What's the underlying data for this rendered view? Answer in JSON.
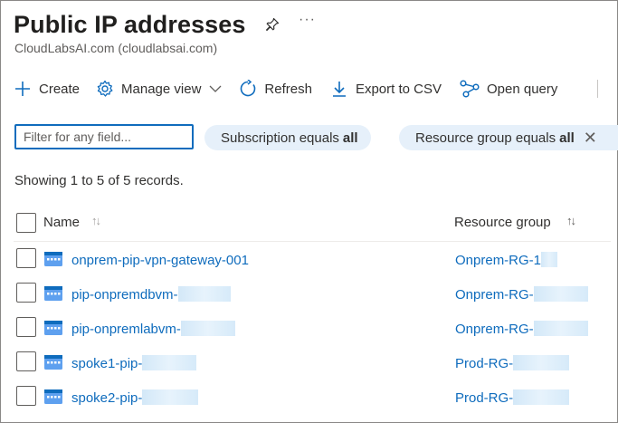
{
  "header": {
    "title": "Public IP addresses",
    "more": "···",
    "subtitle": "CloudLabsAI.com (cloudlabsai.com)"
  },
  "toolbar": {
    "create": "Create",
    "manage_view": "Manage view",
    "refresh": "Refresh",
    "export_csv": "Export to CSV",
    "open_query": "Open query"
  },
  "filters": {
    "search_placeholder": "Filter for any field...",
    "search_value": "",
    "subscription_prefix": "Subscription equals",
    "subscription_value": "all",
    "rg_prefix": "Resource group equals",
    "rg_value": "all",
    "close": "✕"
  },
  "records_text": "Showing 1 to 5 of 5 records.",
  "grid": {
    "col_name": "Name",
    "col_rg": "Resource group",
    "sort_glyph": "↑↓",
    "rows": [
      {
        "name": "onprem-pip-vpn-gateway-001",
        "rg": "Onprem-RG-1"
      },
      {
        "name": "pip-onpremdbvm-",
        "rg": "Onprem-RG-"
      },
      {
        "name": "pip-onpremlabvm-",
        "rg": "Onprem-RG-"
      },
      {
        "name": "spoke1-pip-",
        "rg": "Prod-RG-"
      },
      {
        "name": "spoke2-pip-",
        "rg": "Prod-RG-"
      }
    ]
  },
  "colors": {
    "accent": "#0f6cbd",
    "pill_bg": "#e6f0fa"
  }
}
